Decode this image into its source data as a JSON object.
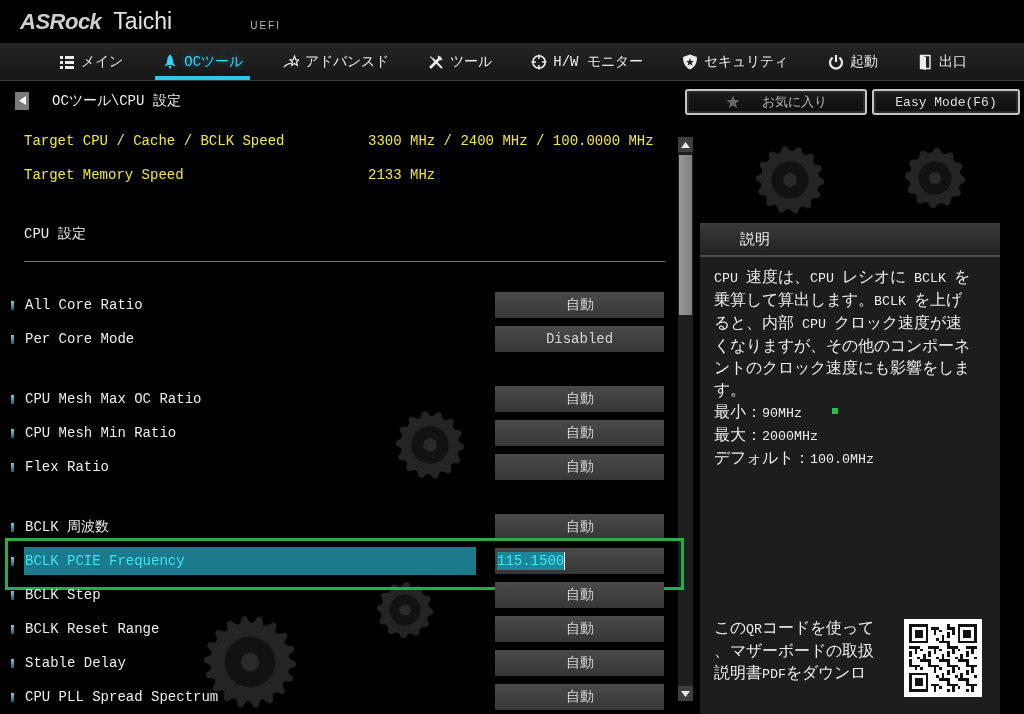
{
  "header": {
    "brand": "ASRock",
    "model": "Taichi",
    "tag": "UEFI"
  },
  "tabs": [
    {
      "label": "メイン",
      "selected": false
    },
    {
      "label": "OCツール",
      "selected": true
    },
    {
      "label": "アドバンスド",
      "selected": false
    },
    {
      "label": "ツール",
      "selected": false
    },
    {
      "label": "H/W モニター",
      "selected": false
    },
    {
      "label": "セキュリティ",
      "selected": false
    },
    {
      "label": "起動",
      "selected": false
    },
    {
      "label": "出口",
      "selected": false
    }
  ],
  "breadcrumb": "OCツール\\CPU 設定",
  "shortcuts": [
    "お気に入り",
    "Easy Mode(F6)"
  ],
  "targets": [
    {
      "label": "Target CPU / Cache / BCLK Speed",
      "value": "3300 MHz / 2400 MHz / 100.0000 MHz"
    },
    {
      "label": "Target Memory Speed",
      "value": "2133 MHz"
    }
  ],
  "section_title": "CPU 設定",
  "groups": [
    {
      "items": [
        {
          "label": "All Core Ratio",
          "value": "自動",
          "selected": false,
          "outlined": false
        },
        {
          "label": "Per Core Mode",
          "value": "Disabled",
          "selected": false,
          "outlined": false
        }
      ]
    },
    {
      "items": [
        {
          "label": "CPU Mesh Max OC Ratio",
          "value": "自動",
          "selected": false,
          "outlined": false
        },
        {
          "label": "CPU Mesh Min Ratio",
          "value": "自動",
          "selected": false,
          "outlined": false
        },
        {
          "label": "Flex Ratio",
          "value": "自動",
          "selected": false,
          "outlined": false
        }
      ]
    },
    {
      "items": [
        {
          "label": "BCLK 周波数",
          "value": "自動",
          "selected": false,
          "outlined": false
        },
        {
          "label": "BCLK PCIE Frequency",
          "value": "115.1500",
          "selected": true,
          "outlined": true
        },
        {
          "label": "BCLK Step",
          "value": "自動",
          "selected": false,
          "outlined": false
        },
        {
          "label": "BCLK Reset Range",
          "value": "自動",
          "selected": false,
          "outlined": false
        },
        {
          "label": "Stable Delay",
          "value": "自動",
          "selected": false,
          "outlined": false
        },
        {
          "label": "CPU PLL Spread Spectrum",
          "value": "自動",
          "selected": false,
          "outlined": false
        }
      ]
    }
  ],
  "help": {
    "title": "説明",
    "text": "CPU 速度は、CPU レシオに BCLK を乗算して算出します。BCLK を上げると、内部 CPU クロック速度が速くなりますが、その他のコンポーネントのクロック速度にも影響をします。",
    "limits": [
      "最小：90MHz",
      "最大：2000MHz",
      "デフォルト：100.0MHz"
    ],
    "qr_text": "このQRコードを使って、マザーボードの取扱説明書PDFをダウンロ"
  }
}
